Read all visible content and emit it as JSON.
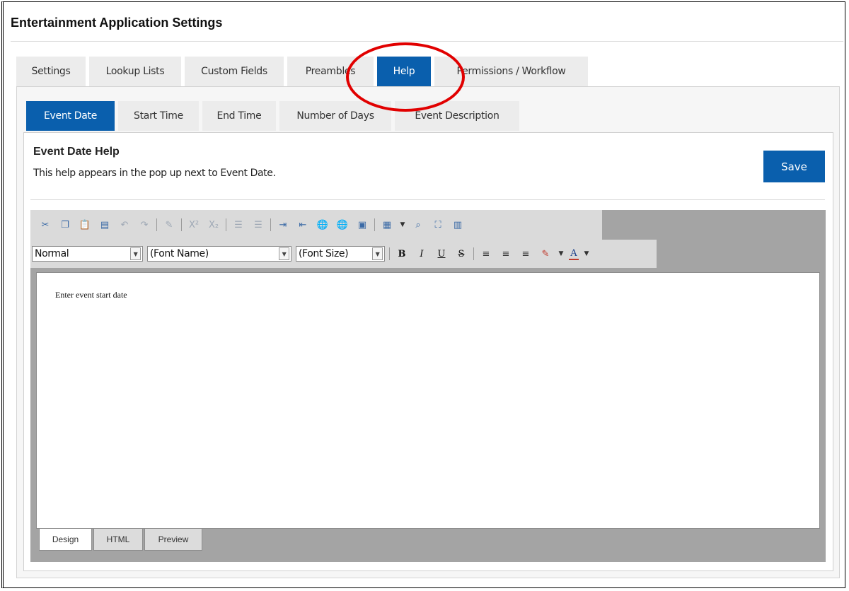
{
  "page": {
    "title": "Entertainment Application Settings"
  },
  "main_tabs": [
    {
      "label": "Settings",
      "active": false
    },
    {
      "label": "Lookup Lists",
      "active": false
    },
    {
      "label": "Custom Fields",
      "active": false
    },
    {
      "label": "Preambles",
      "active": false
    },
    {
      "label": "Help",
      "active": true
    },
    {
      "label": "Permissions / Workflow",
      "active": false
    }
  ],
  "sub_tabs": [
    {
      "label": "Event Date",
      "active": true
    },
    {
      "label": "Start Time",
      "active": false
    },
    {
      "label": "End Time",
      "active": false
    },
    {
      "label": "Number of Days",
      "active": false
    },
    {
      "label": "Event Description",
      "active": false
    }
  ],
  "section": {
    "title": "Event Date Help",
    "description": "This help appears in the pop up next to Event Date.",
    "save_label": "Save"
  },
  "editor": {
    "toolbar_row1_icons": [
      "cut-icon",
      "copy-icon",
      "paste-icon",
      "paste-text-icon",
      "undo-icon",
      "redo-icon",
      "format-painter-icon",
      "superscript-icon",
      "subscript-icon",
      "ordered-list-icon",
      "unordered-list-icon",
      "indent-icon",
      "outdent-icon",
      "insert-link-icon",
      "remove-link-icon",
      "insert-image-icon",
      "insert-table-icon",
      "find-icon",
      "fullscreen-icon",
      "media-icon"
    ],
    "toolbar_row1_glyphs": {
      "superscript": "X²",
      "subscript": "X₂"
    },
    "paragraph_format": "Normal",
    "font_name": "(Font Name)",
    "font_size": "(Font Size)",
    "format_buttons": {
      "bold": "B",
      "italic": "I",
      "underline": "U",
      "strike": "S",
      "font_color": "A"
    },
    "content": "Enter event start date",
    "mode_tabs": [
      {
        "label": "Design",
        "active": true
      },
      {
        "label": "HTML",
        "active": false
      },
      {
        "label": "Preview",
        "active": false
      }
    ]
  },
  "colors": {
    "accent": "#0a5fad",
    "annotation": "#e10000",
    "toolbar": "#dadada",
    "editor_frame": "#a4a4a4"
  }
}
